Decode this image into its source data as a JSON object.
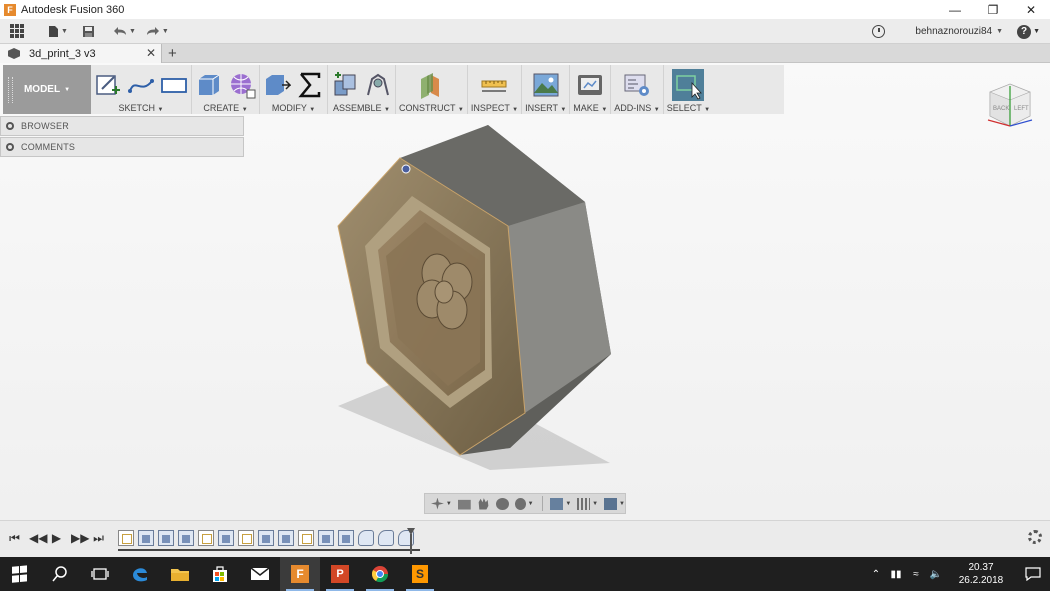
{
  "window": {
    "title": "Autodesk Fusion 360",
    "controls": [
      "minimize",
      "restore",
      "close"
    ]
  },
  "appbar": {
    "user": "behnaznorouzi84",
    "icons": [
      "grid-icon",
      "file-icon",
      "save-icon",
      "undo-icon",
      "redo-icon",
      "clock-icon",
      "help-icon"
    ]
  },
  "document_tab": {
    "name": "3d_print_3 v3"
  },
  "toolbar": {
    "workspace": "MODEL",
    "groups": [
      {
        "label": "SKETCH",
        "icons": [
          "create-sketch-icon",
          "line-icon",
          "rectangle-icon"
        ]
      },
      {
        "label": "CREATE",
        "icons": [
          "extrude-icon",
          "sculpt-icon"
        ]
      },
      {
        "label": "MODIFY",
        "icons": [
          "press-pull-icon",
          "sigma-icon"
        ]
      },
      {
        "label": "ASSEMBLE",
        "icons": [
          "new-component-icon",
          "joint-icon"
        ]
      },
      {
        "label": "CONSTRUCT",
        "icons": [
          "plane-icon"
        ]
      },
      {
        "label": "INSPECT",
        "icons": [
          "measure-icon"
        ]
      },
      {
        "label": "INSERT",
        "icons": [
          "image-icon"
        ]
      },
      {
        "label": "MAKE",
        "icons": [
          "print-icon"
        ]
      },
      {
        "label": "ADD-INS",
        "icons": [
          "scripts-icon"
        ]
      },
      {
        "label": "SELECT",
        "icons": [
          "select-icon"
        ]
      }
    ]
  },
  "panels": {
    "browser": "BROWSER",
    "comments": "COMMENTS"
  },
  "viewcube": {
    "faces": [
      "BACK",
      "LEFT"
    ]
  },
  "clock": {
    "time": "20.37",
    "date": "26.2.2018"
  },
  "colors": {
    "model_body": "#8a7a5e",
    "model_side": "#6f6f6c",
    "toolbar_bg": "#e8e8e8",
    "select_active": "#4f7f99",
    "taskbar": "#1f1f1f"
  }
}
